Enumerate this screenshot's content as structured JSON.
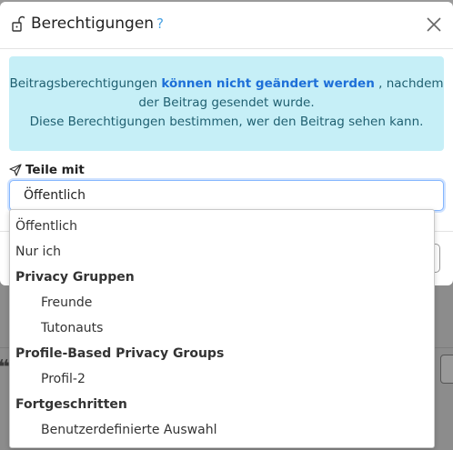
{
  "modal": {
    "title": "Berechtigungen",
    "help_icon": "?",
    "close_icon": "close-icon",
    "lock_icon": "lock-open-icon"
  },
  "info": {
    "line1_prefix": "Beitragsberechtigungen",
    "line1_strong": "können nicht geändert werden",
    "line1_suffix": ", nachdem",
    "line2": "der Beitrag gesendet wurde.",
    "line3": "Diese Berechtigungen bestimmen, wer den Beitrag sehen kann."
  },
  "share": {
    "label": "Teile mit",
    "icon": "send-icon",
    "selected": "Öffentlich"
  },
  "dropdown": {
    "items": [
      {
        "type": "option",
        "label": "Öffentlich"
      },
      {
        "type": "option",
        "label": "Nur ich"
      },
      {
        "type": "group",
        "label": "Privacy Gruppen"
      },
      {
        "type": "suboption",
        "label": "Freunde"
      },
      {
        "type": "suboption",
        "label": "Tutonauts"
      },
      {
        "type": "group",
        "label": "Profile-Based Privacy Groups"
      },
      {
        "type": "suboption",
        "label": "Profil-2"
      },
      {
        "type": "group",
        "label": "Fortgeschritten"
      },
      {
        "type": "suboption",
        "label": "Benutzerdefinierte Auswahl"
      }
    ]
  },
  "colors": {
    "info_bg": "#c6eff7",
    "info_text": "#1f5f70",
    "info_strong": "#1d6fd8",
    "focus_border": "#86b7fe",
    "help_icon": "#4ba3e3"
  }
}
